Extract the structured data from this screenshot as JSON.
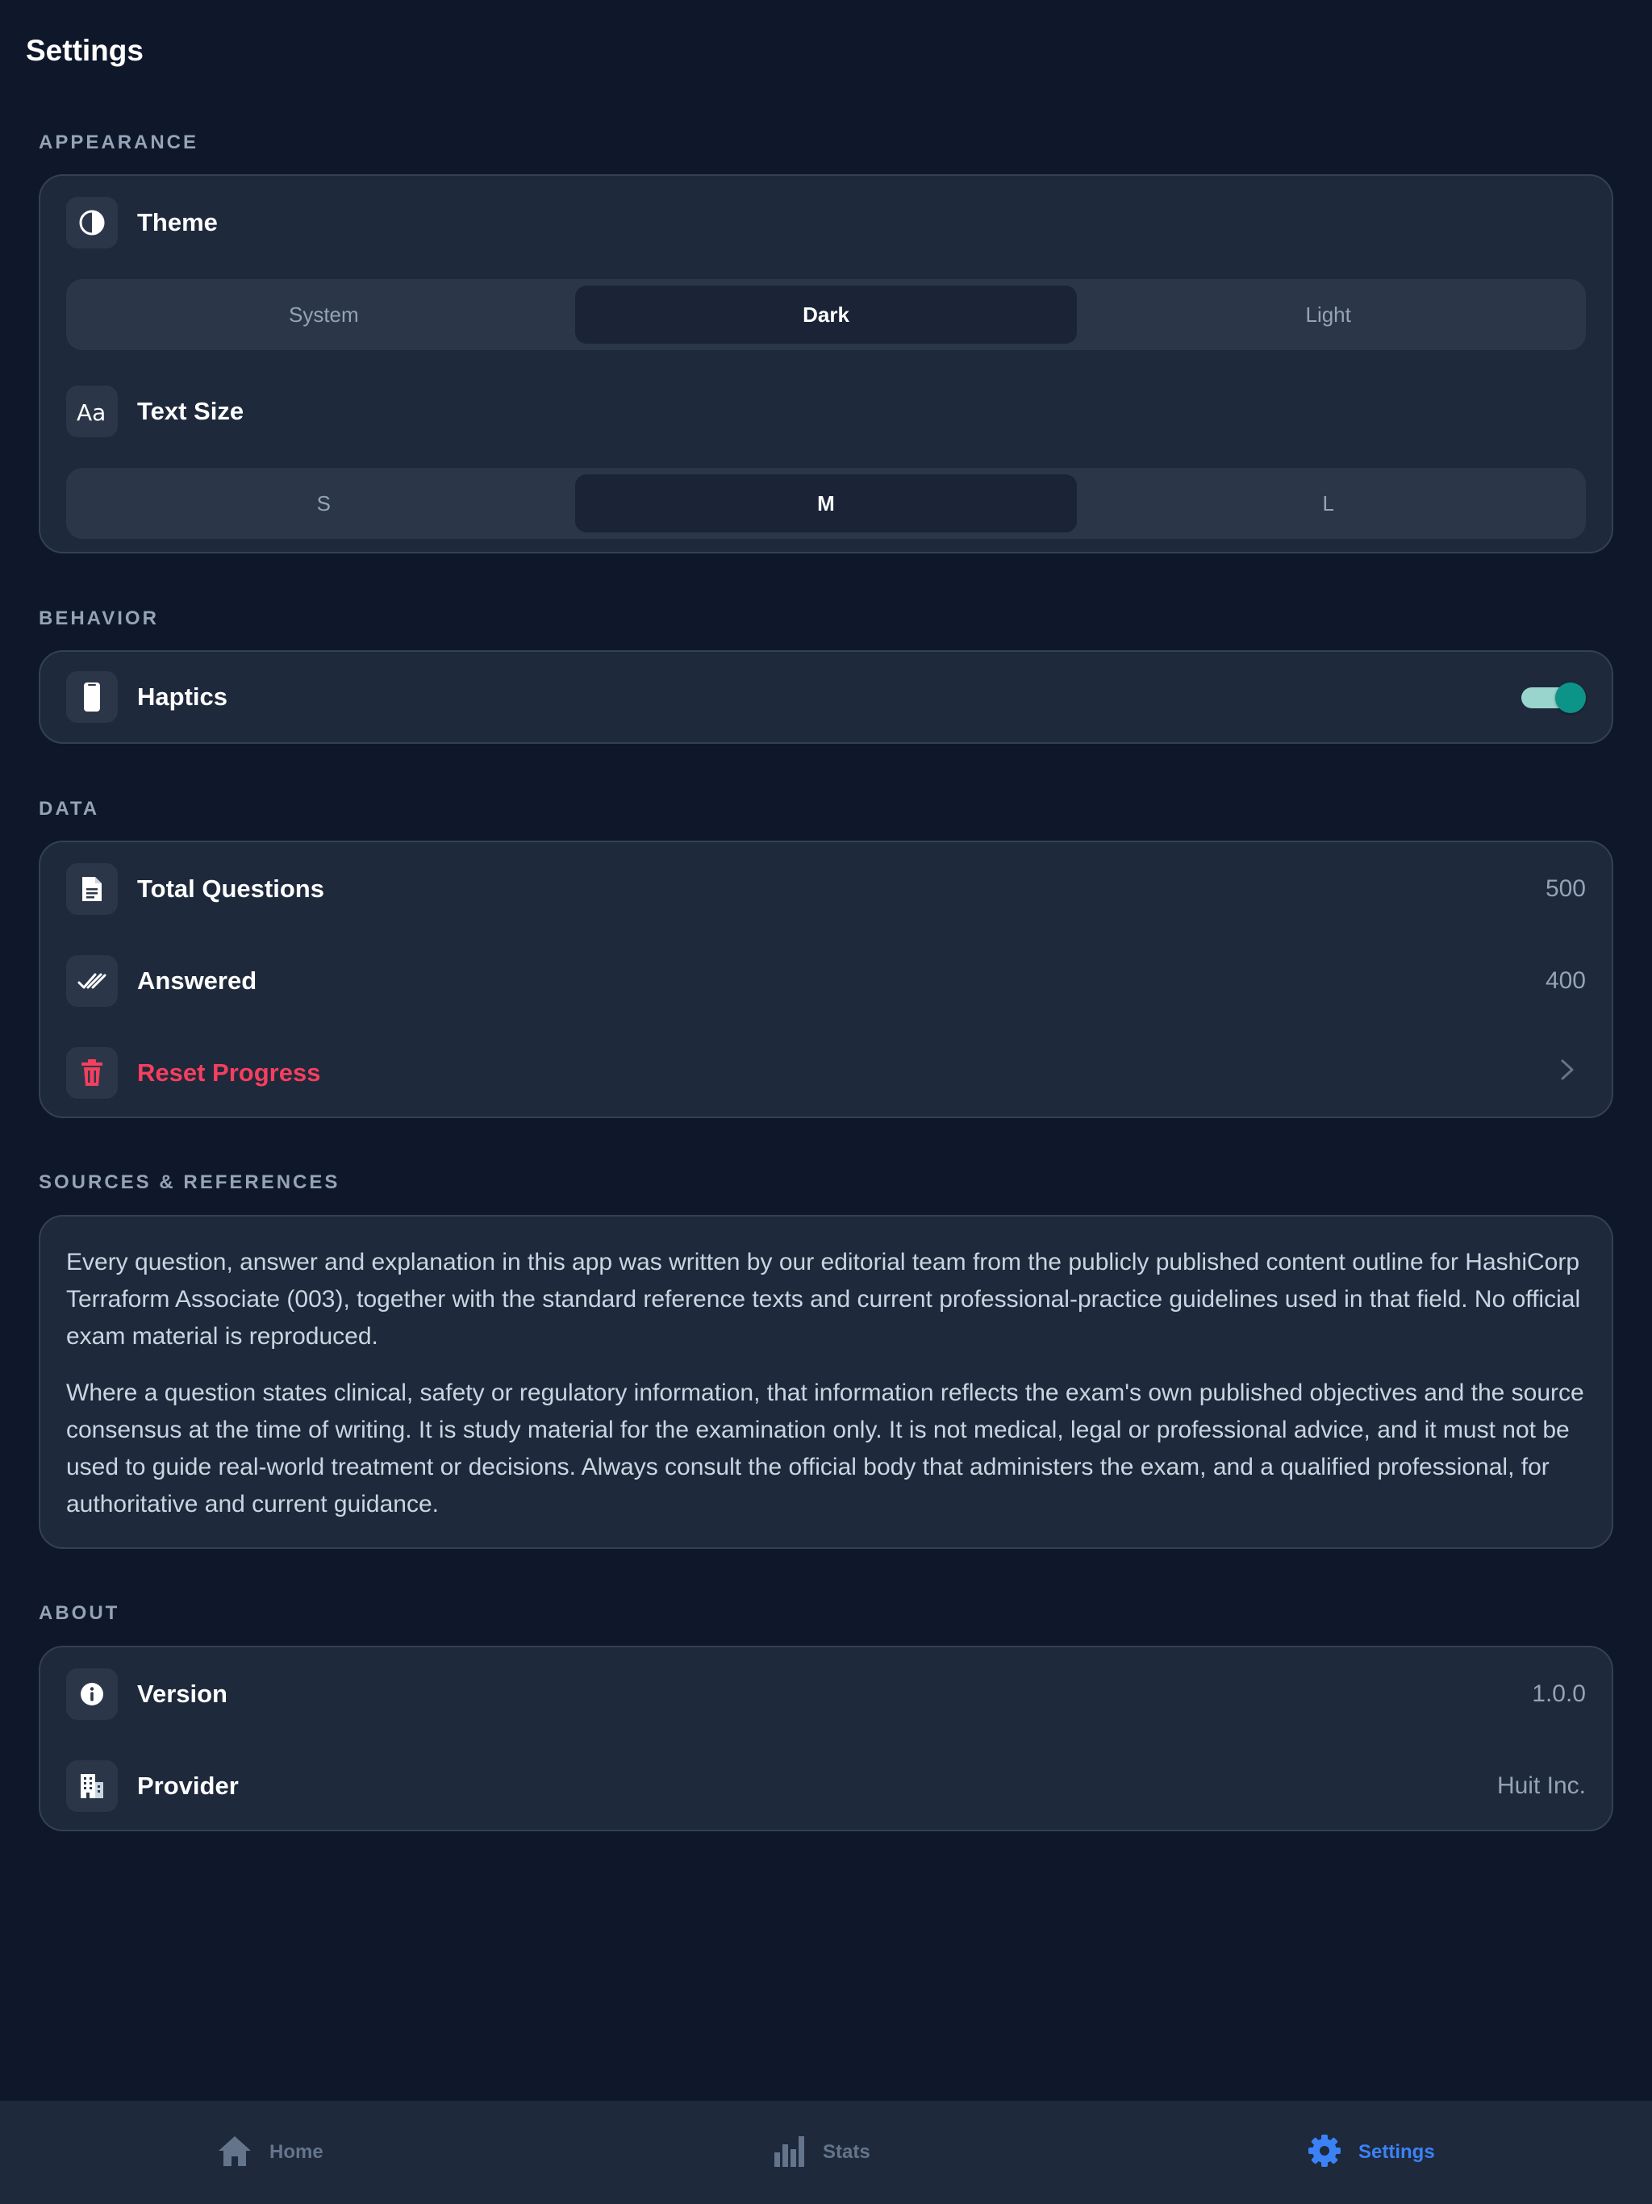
{
  "page": {
    "title": "Settings"
  },
  "appearance": {
    "section_label": "APPEARANCE",
    "theme": {
      "label": "Theme",
      "icon": "contrast-icon",
      "options": [
        "System",
        "Dark",
        "Light"
      ],
      "selected": "Dark"
    },
    "text_size": {
      "label": "Text Size",
      "icon": "text-size-icon",
      "options": [
        "S",
        "M",
        "L"
      ],
      "selected": "M"
    }
  },
  "behavior": {
    "section_label": "BEHAVIOR",
    "haptics": {
      "label": "Haptics",
      "icon": "phone-icon",
      "enabled": true
    }
  },
  "data": {
    "section_label": "DATA",
    "total_questions": {
      "label": "Total Questions",
      "value": "500",
      "icon": "document-icon"
    },
    "answered": {
      "label": "Answered",
      "value": "400",
      "icon": "double-check-icon"
    },
    "reset": {
      "label": "Reset Progress",
      "icon": "trash-icon"
    }
  },
  "sources": {
    "section_label": "SOURCES & REFERENCES",
    "paragraphs": [
      "Every question, answer and explanation in this app was written by our editorial team from the publicly published content outline for HashiCorp Terraform Associate (003), together with the standard reference texts and current professional-practice guidelines used in that field. No official exam material is reproduced.",
      "Where a question states clinical, safety or regulatory information, that information reflects the exam's own published objectives and the source consensus at the time of writing. It is study material for the examination only. It is not medical, legal or professional advice, and it must not be used to guide real-world treatment or decisions. Always consult the official body that administers the exam, and a qualified professional, for authoritative and current guidance."
    ]
  },
  "about": {
    "section_label": "ABOUT",
    "version": {
      "label": "Version",
      "value": "1.0.0",
      "icon": "info-icon"
    },
    "provider": {
      "label": "Provider",
      "value": "Huit Inc.",
      "icon": "building-icon"
    }
  },
  "tabbar": {
    "tabs": [
      {
        "label": "Home",
        "icon": "home-icon"
      },
      {
        "label": "Stats",
        "icon": "bar-chart-icon"
      },
      {
        "label": "Settings",
        "icon": "gear-icon"
      }
    ],
    "active": "Settings"
  },
  "colors": {
    "background": "#0f172a",
    "card": "#1e293b",
    "accent": "#3b82f6",
    "toggle_on": "#0d9488",
    "danger": "#f43f5e"
  }
}
